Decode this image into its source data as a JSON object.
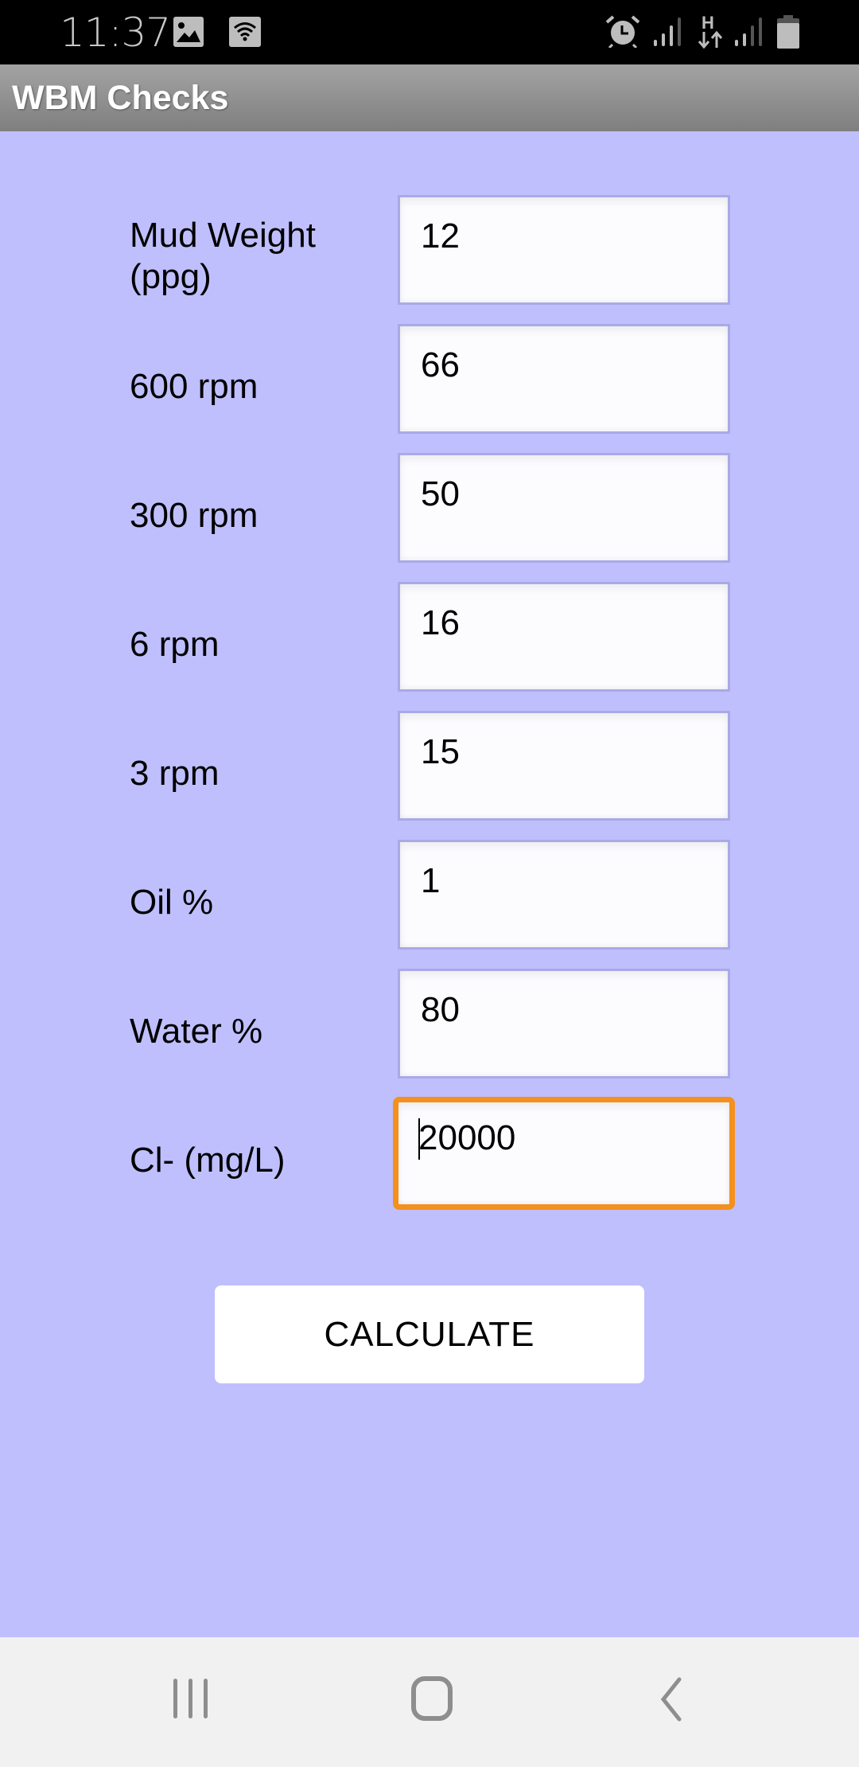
{
  "status_bar": {
    "time": "11:37",
    "left_icons": [
      "gallery-icon",
      "wifi-hotspot-icon"
    ],
    "right_icons": [
      "alarm-icon",
      "signal-icon",
      "h-data-icon",
      "signal-icon",
      "battery-icon"
    ],
    "data_network_label": "H"
  },
  "app_bar": {
    "title": "WBM Checks"
  },
  "form": {
    "fields": [
      {
        "label": "Mud Weight (ppg)",
        "value": "12"
      },
      {
        "label": "600 rpm",
        "value": "66"
      },
      {
        "label": "300 rpm",
        "value": "50"
      },
      {
        "label": "6 rpm",
        "value": "16"
      },
      {
        "label": "3 rpm",
        "value": "15"
      },
      {
        "label": "Oil %",
        "value": "1"
      },
      {
        "label": "Water %",
        "value": "80"
      },
      {
        "label": "Cl- (mg/L)",
        "value": "20000",
        "focused": true
      }
    ],
    "calculate_label": "CALCULATE"
  },
  "nav_bar": {
    "buttons": [
      "recent-apps",
      "home",
      "back"
    ]
  },
  "colors": {
    "background": "#bfbffe",
    "focus_border": "#f3901e",
    "app_bar": "#909090"
  }
}
